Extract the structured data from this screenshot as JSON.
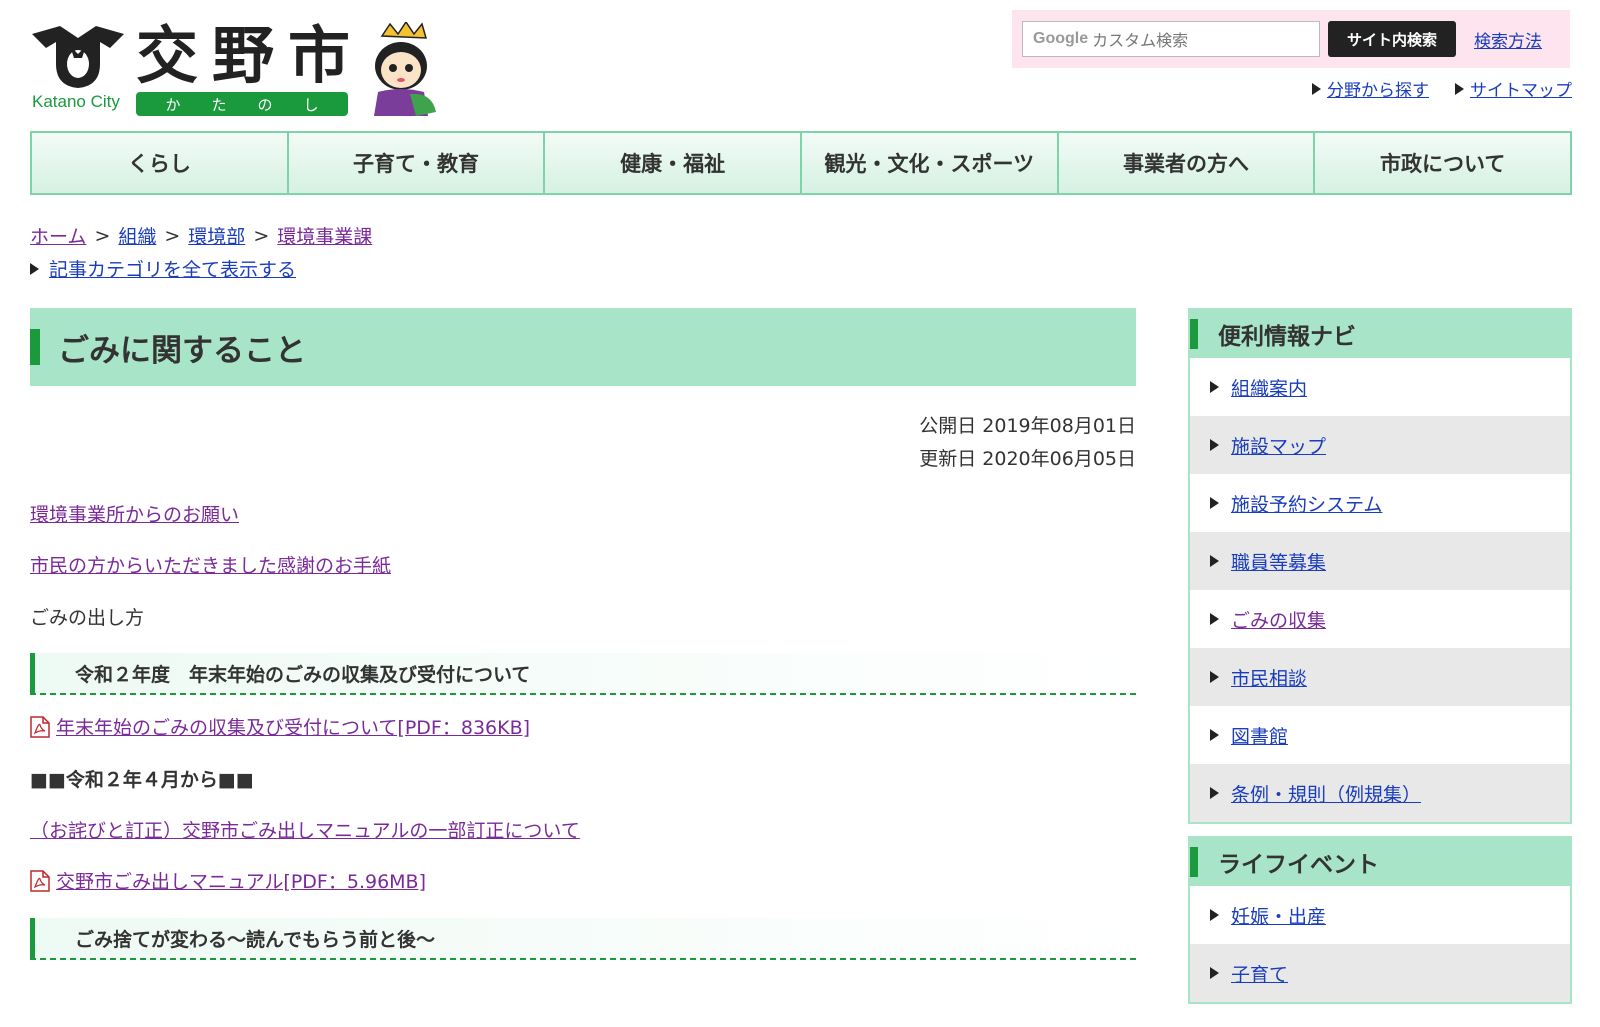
{
  "header": {
    "city_en": "Katano City",
    "city_jp": "交野市",
    "kana": [
      "か",
      "た",
      "の",
      "し"
    ],
    "search": {
      "placeholder": "カスタム検索",
      "google_label": "Google",
      "button_label": "サイト内検索",
      "help_label": "検索方法"
    },
    "util_links": [
      "分野から探す",
      "サイトマップ"
    ]
  },
  "nav": {
    "items": [
      "くらし",
      "子育て・教育",
      "健康・福祉",
      "観光・文化・スポーツ",
      "事業者の方へ",
      "市政について"
    ]
  },
  "breadcrumb": {
    "items": [
      "ホーム",
      "組織",
      "環境部",
      "環境事業課"
    ],
    "separator": ">",
    "category_link": "記事カテゴリを全て表示する"
  },
  "main": {
    "title": "ごみに関すること",
    "published": "公開日 2019年08月01日",
    "updated": "更新日 2020年06月05日",
    "link1": "環境事業所からのお願い",
    "link2": "市民の方からいただきました感謝のお手紙",
    "text1": "ごみの出し方",
    "heading1": "令和２年度　年末年始のごみの収集及び受付について",
    "pdf1": "年末年始のごみの収集及び受付について[PDF：836KB]",
    "bold1": "■■令和２年４月から■■",
    "link3": "（お詫びと訂正）交野市ごみ出しマニュアルの一部訂正について",
    "pdf2": "交野市ごみ出しマニュアル[PDF：5.96MB]",
    "heading2": "ごみ捨てが変わる～読んでもらう前と後～"
  },
  "sidebar": {
    "navi_title": "便利情報ナビ",
    "navi_items": [
      "組織案内",
      "施設マップ",
      "施設予約システム",
      "職員等募集",
      "ごみの収集",
      "市民相談",
      "図書館",
      "条例・規則（例規集）"
    ],
    "life_title": "ライフイベント",
    "life_items": [
      "妊娠・出産",
      "子育て"
    ]
  },
  "colors": {
    "accent_green": "#1a9a3c",
    "light_green": "#a8e4c8",
    "search_bg": "#fde4ef",
    "link_blue": "#1a3dbd",
    "link_visited": "#7a2a9a"
  }
}
